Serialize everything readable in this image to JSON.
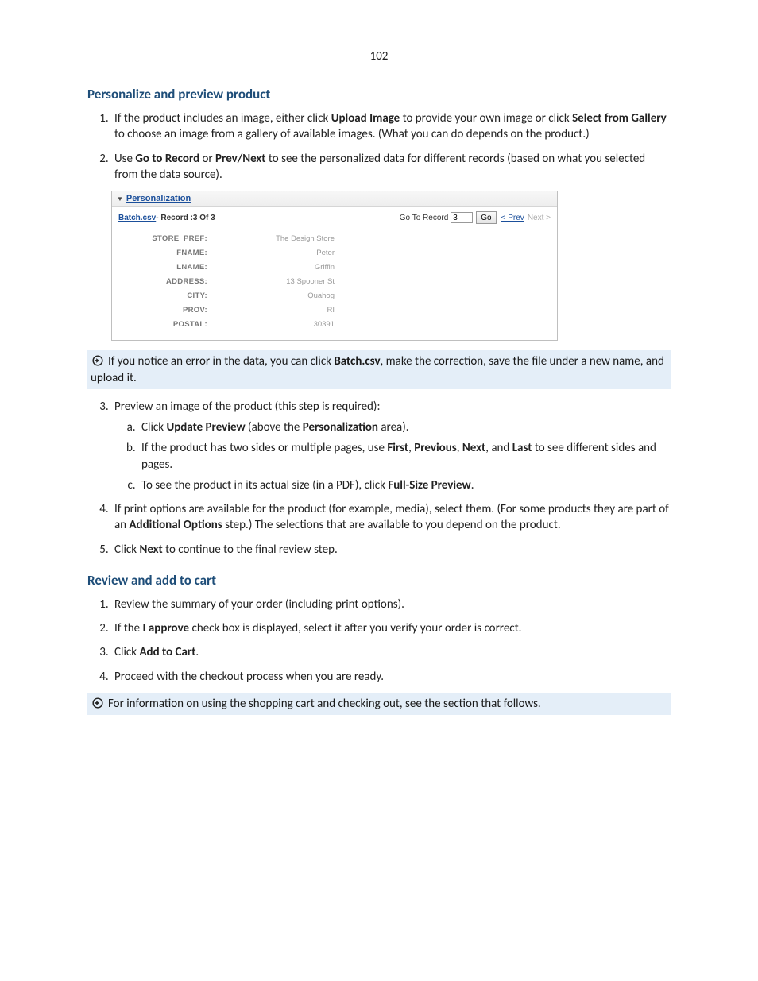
{
  "page_number": "102",
  "section1": {
    "title": "Personalize and preview product",
    "items": {
      "0": {
        "pre1": "If the product includes an image, either click ",
        "b1": "Upload Image",
        "mid1": " to provide your own image or click ",
        "b2": "Select from Gallery",
        "post1": " to choose an image from a gallery of available images. (What you can do depends on the product.)"
      },
      "1": {
        "pre1": "Use ",
        "b1": "Go to Record",
        "mid1": " or ",
        "b2": "Prev/Next",
        "post1": " to see the personalized data for different records (based on what you selected from the data source)."
      },
      "2": {
        "text": "Preview an image of the product (this step is required):",
        "sub": {
          "0": {
            "pre1": "Click ",
            "b1": "Update Preview",
            "mid1": " (above the ",
            "b2": "Personalization",
            "post1": " area)."
          },
          "1": {
            "pre1": "If the product has two sides or multiple pages, use ",
            "b1": "First",
            "c1": ", ",
            "b2": "Previous",
            "c2": ", ",
            "b3": "Next",
            "c3": ", and ",
            "b4": "Last",
            "post1": " to see different sides and pages."
          },
          "2": {
            "pre1": "To see the product in its actual size (in a PDF), click ",
            "b1": "Full-Size Preview",
            "post1": "."
          }
        }
      },
      "3": {
        "pre1": "If print options are available for the product (for example, media), select them. (For some products they are part of an ",
        "b1": "Additional Options",
        "post1": " step.) The selections that are available to you depend on the product."
      },
      "4": {
        "pre1": "Click ",
        "b1": "Next",
        "post1": " to continue to the final review step."
      }
    },
    "note1": {
      "pre1": "If you notice an error in the data, you can click ",
      "b1": "Batch.csv",
      "post1": ", make the correction, save the file under a new name, and upload it."
    }
  },
  "ui_panel": {
    "header": "Personalization",
    "batch_link": "Batch.csv",
    "record_text": "- Record :3 Of 3",
    "goto_label": "Go To Record",
    "goto_value": "3",
    "go_label": "Go",
    "prev_label": "< Prev",
    "next_label": "Next >",
    "fields": {
      "0": {
        "label": "STORE_PREF:",
        "value": "The Design Store"
      },
      "1": {
        "label": "FNAME:",
        "value": "Peter"
      },
      "2": {
        "label": "LNAME:",
        "value": "Griffin"
      },
      "3": {
        "label": "ADDRESS:",
        "value": "13 Spooner St"
      },
      "4": {
        "label": "CITY:",
        "value": "Quahog"
      },
      "5": {
        "label": "PROV:",
        "value": "RI"
      },
      "6": {
        "label": "POSTAL:",
        "value": "30391"
      }
    }
  },
  "section2": {
    "title": "Review and add to cart",
    "items": {
      "0": {
        "text": "Review the summary of your order (including print options)."
      },
      "1": {
        "pre1": "If the ",
        "b1": "I approve",
        "post1": " check box is displayed, select it after you verify your order is correct."
      },
      "2": {
        "pre1": "Click ",
        "b1": "Add to Cart",
        "post1": "."
      },
      "3": {
        "text": "Proceed with the checkout process when you are ready."
      }
    },
    "note2": {
      "text": "For information on using the shopping cart and checking out, see the section that follows."
    }
  }
}
